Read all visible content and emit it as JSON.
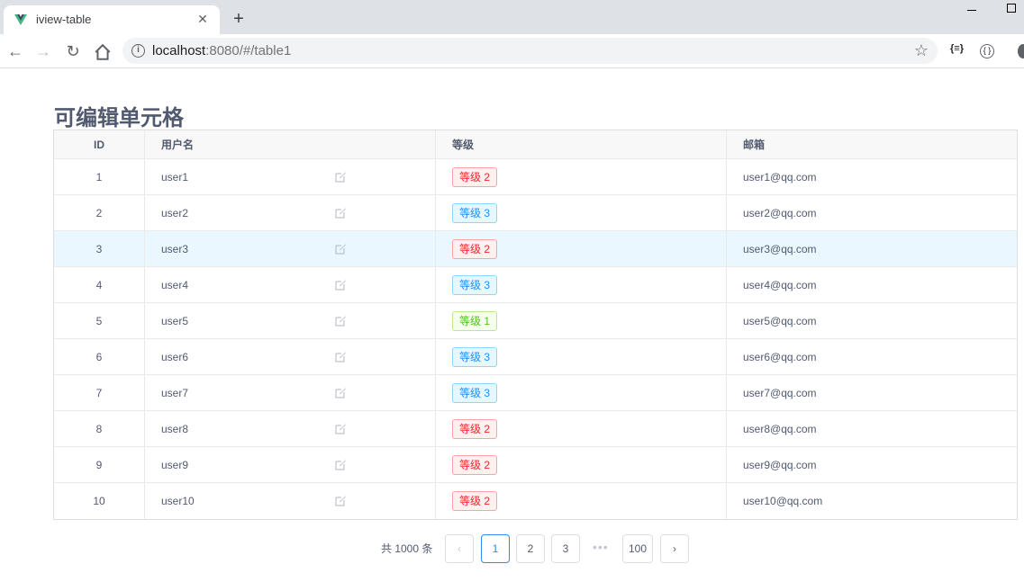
{
  "browser": {
    "tab_title": "iview-table",
    "url_host": "localhost",
    "url_rest": ":8080/#/table1"
  },
  "page": {
    "title": "可编辑单元格"
  },
  "table": {
    "columns": [
      "ID",
      "用户名",
      "等级",
      "邮箱"
    ],
    "rows": [
      {
        "id": "1",
        "user": "user1",
        "level": "等级 2",
        "level_type": "lv2",
        "email": "user1@qq.com"
      },
      {
        "id": "2",
        "user": "user2",
        "level": "等级 3",
        "level_type": "lv3",
        "email": "user2@qq.com"
      },
      {
        "id": "3",
        "user": "user3",
        "level": "等级 2",
        "level_type": "lv2",
        "email": "user3@qq.com"
      },
      {
        "id": "4",
        "user": "user4",
        "level": "等级 3",
        "level_type": "lv3",
        "email": "user4@qq.com"
      },
      {
        "id": "5",
        "user": "user5",
        "level": "等级 1",
        "level_type": "lv1",
        "email": "user5@qq.com"
      },
      {
        "id": "6",
        "user": "user6",
        "level": "等级 3",
        "level_type": "lv3",
        "email": "user6@qq.com"
      },
      {
        "id": "7",
        "user": "user7",
        "level": "等级 3",
        "level_type": "lv3",
        "email": "user7@qq.com"
      },
      {
        "id": "8",
        "user": "user8",
        "level": "等级 2",
        "level_type": "lv2",
        "email": "user8@qq.com"
      },
      {
        "id": "9",
        "user": "user9",
        "level": "等级 2",
        "level_type": "lv2",
        "email": "user9@qq.com"
      },
      {
        "id": "10",
        "user": "user10",
        "level": "等级 2",
        "level_type": "lv2",
        "email": "user10@qq.com"
      }
    ],
    "highlighted_row": 3
  },
  "pagination": {
    "total_label": "共 1000 条",
    "prev": "‹",
    "pages": [
      "1",
      "2",
      "3"
    ],
    "ellipsis": "•••",
    "last": "100",
    "next": "›",
    "current": "1"
  },
  "colors": {
    "level2": "#f5222d",
    "level3": "#1890ff",
    "level1": "#52c41a",
    "active_page": "#2d8cf0"
  }
}
